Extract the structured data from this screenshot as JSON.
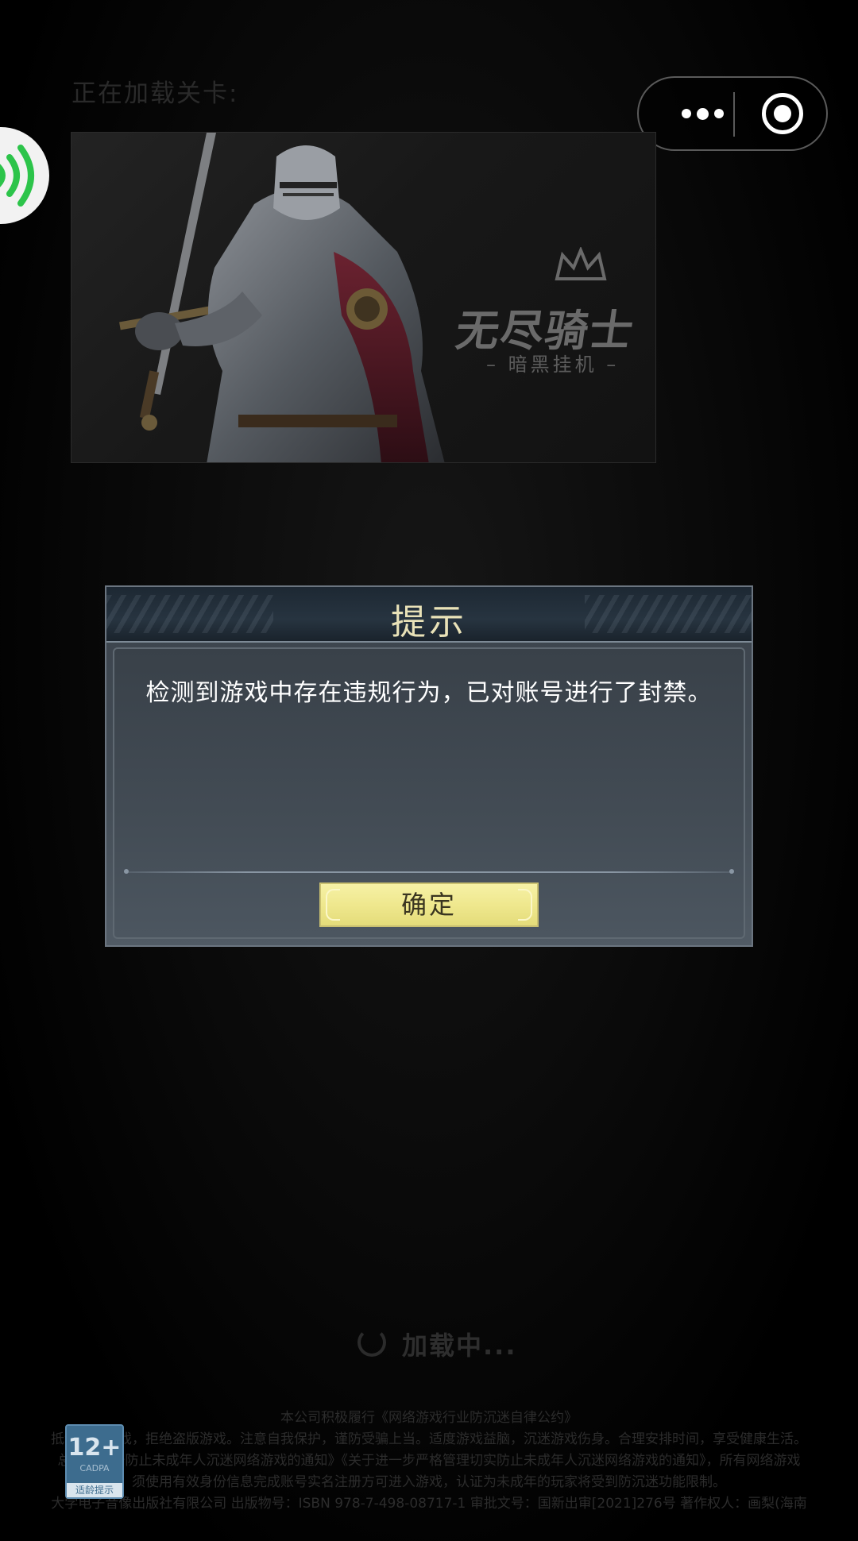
{
  "loading_header": {
    "label": "正在加载关卡:"
  },
  "capsule": {
    "more_icon": "more-dots-icon",
    "close_icon": "target-close-icon"
  },
  "voice_ball": {
    "icon": "sound-wave-icon",
    "color": "#2cc44a"
  },
  "banner": {
    "title": "无尽骑士",
    "subtitle": "– 暗黑挂机 –",
    "crown_icon": "crown-icon"
  },
  "dialog": {
    "title": "提示",
    "message": "检测到游戏中存在违规行为，已对账号进行了封禁。",
    "confirm_label": "确定",
    "confirm_color": "#efe88e"
  },
  "loading": {
    "text": "加载中..."
  },
  "footer": {
    "line1": "本公司积极履行《网络游戏行业防沉迷自律公约》",
    "line2": "抵制不良游戏，拒绝盗版游戏。注意自我保护，谨防受骗上当。适度游戏益脑，沉迷游戏伤身。合理安排时间，享受健康生活。",
    "line3": "总署《关于防止未成年人沉迷网络游戏的通知》《关于进一步严格管理切实防止未成年人沉迷网络游戏的通知》，所有网络游戏",
    "line4": "须使用有效身份信息完成账号实名注册方可进入游戏，认证为未成年的玩家将受到防沉迷功能限制。",
    "line5": "大学电子音像出版社有限公司  出版物号：ISBN 978-7-498-08717-1  审批文号：国新出审[2021]276号  著作权人：画梨(海南",
    "age_rating": "12+",
    "age_org": "CADPA",
    "age_tip": "适龄提示"
  }
}
